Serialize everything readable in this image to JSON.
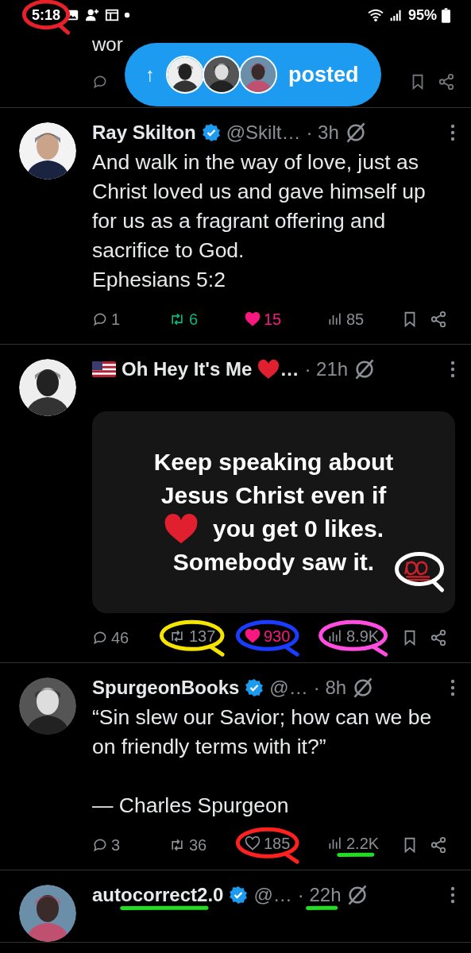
{
  "status_bar": {
    "time": "5:18",
    "time_marker": {
      "kind": "loop",
      "color": "#e8202a"
    },
    "battery": "95%"
  },
  "partial_post": {
    "text": "wor"
  },
  "new_posts_pill": {
    "arrow": "↑",
    "label": "posted"
  },
  "posts": [
    {
      "display_name": "Ray Skilton",
      "verified": true,
      "handle": "@Skilt…",
      "time": "· 3h",
      "text": "And walk in the way of love, just as Christ loved us and gave himself up for us as a fragrant offering and sacrifice to God.\nEphesians 5:2",
      "stats": {
        "replies": {
          "value": "1"
        },
        "reposts": {
          "value": "6",
          "active": true
        },
        "likes": {
          "value": "15",
          "active": true
        },
        "views": {
          "value": "85"
        }
      }
    },
    {
      "display_name": "Oh Hey It's Me",
      "name_badges_before": [
        {
          "kind": "flag"
        }
      ],
      "name_badges_after": [
        {
          "kind": "heart"
        }
      ],
      "ellipsis": "…",
      "verified": false,
      "time": "· 21h",
      "image_card": {
        "lines": [
          {
            "text": "Keep speaking about"
          },
          {
            "text": "Jesus Christ even if"
          },
          {
            "text": "you get 0 likes.",
            "heart_before": true
          },
          {
            "text": "Somebody saw it."
          }
        ],
        "marker": {
          "kind": "loop",
          "color": "#ffffff"
        }
      },
      "stats": {
        "replies": {
          "value": "46"
        },
        "reposts": {
          "value": "137",
          "active": false,
          "marker": {
            "kind": "loop",
            "color": "#f5e400"
          }
        },
        "likes": {
          "value": "930",
          "active": true,
          "marker": {
            "kind": "loop",
            "color": "#1a3cff"
          }
        },
        "views": {
          "value": "8.9K",
          "marker": {
            "kind": "loop",
            "color": "#ff4de0"
          }
        }
      }
    },
    {
      "display_name": "SpurgeonBooks",
      "verified": true,
      "handle": "@…",
      "time": "· 8h",
      "text": "“Sin slew our Savior; how can we be on friendly terms with it?”\n\n— Charles Spurgeon",
      "stats": {
        "replies": {
          "value": "3"
        },
        "reposts": {
          "value": "36",
          "active": false
        },
        "likes": {
          "value": "185",
          "active": false,
          "marker": {
            "kind": "loop",
            "color": "#ff2020"
          }
        },
        "views": {
          "value": "2.2K",
          "marker": {
            "kind": "underline",
            "color": "#22dd22"
          }
        }
      }
    },
    {
      "display_name": "autocorrect2.0",
      "name_marker": {
        "kind": "underline",
        "color": "#22dd22"
      },
      "verified": true,
      "handle": "@…",
      "time": "· 22h",
      "time_marker": {
        "kind": "underline",
        "color": "#22dd22"
      }
    }
  ]
}
